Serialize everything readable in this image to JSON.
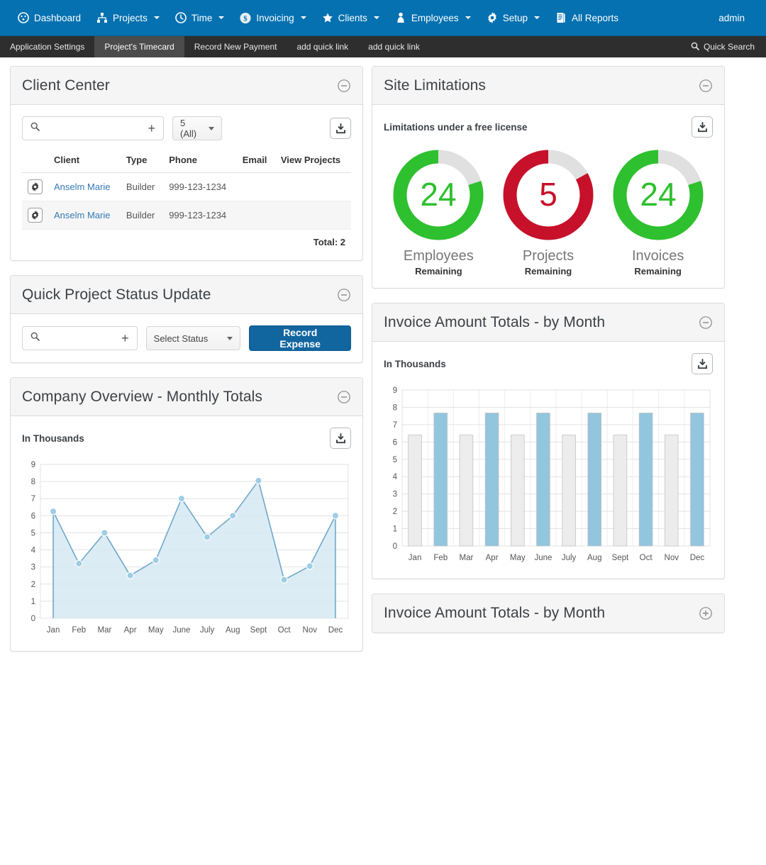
{
  "navbar": {
    "items": [
      {
        "label": "Dashboard",
        "icon": "dashboard-icon",
        "caret": false
      },
      {
        "label": "Projects",
        "icon": "sitemap-icon",
        "caret": true
      },
      {
        "label": "Time",
        "icon": "clock-icon",
        "caret": true
      },
      {
        "label": "Invoicing",
        "icon": "dollar-circle-icon",
        "caret": true
      },
      {
        "label": "Clients",
        "icon": "star-icon",
        "caret": true
      },
      {
        "label": "Employees",
        "icon": "user-tie-icon",
        "caret": true
      },
      {
        "label": "Setup",
        "icon": "gear-icon",
        "caret": true
      },
      {
        "label": "All Reports",
        "icon": "report-icon",
        "caret": false
      }
    ],
    "user": "admin",
    "brand_color": "#0571b0"
  },
  "subnav": {
    "items": [
      {
        "label": "Application Settings",
        "active": false
      },
      {
        "label": "Project's Timecard",
        "active": true
      },
      {
        "label": "Record New Payment",
        "active": false
      },
      {
        "label": "add quick link",
        "active": false
      },
      {
        "label": "add quick link",
        "active": false
      }
    ],
    "quick_search": "Quick Search",
    "background_color": "#2e2e2e"
  },
  "client_center": {
    "title": "Client Center",
    "search_placeholder": "",
    "search_value": "",
    "add_label": "+",
    "page_size": "5 (All)",
    "download_label": "download-icon",
    "columns": [
      "Client",
      "Type",
      "Phone",
      "Email",
      "View Projects"
    ],
    "rows": [
      {
        "client": "Anselm Marie",
        "type": "Builder",
        "phone": "999-123-1234",
        "email": "",
        "view_projects": ""
      },
      {
        "client": "Anselm Marie",
        "type": "Builder",
        "phone": "999-123-1234",
        "email": "",
        "view_projects": ""
      }
    ],
    "total": "Total: 2"
  },
  "site_limitations": {
    "title": "Site Limitations",
    "subtitle": "Limitations under a free license",
    "gauges": [
      {
        "value": "24",
        "name": "Employees",
        "sub": "Remaining",
        "percent": 80,
        "color": "#2ec02e"
      },
      {
        "value": "5",
        "name": "Projects",
        "sub": "Remaining",
        "percent": 83,
        "color": "#c7102a"
      },
      {
        "value": "24",
        "name": "Invoices",
        "sub": "Remaining",
        "percent": 80,
        "color": "#2ec02e"
      }
    ],
    "track_color": "#e0e0e0"
  },
  "quick_status": {
    "title": "Quick Project Status Update",
    "search_placeholder": "",
    "search_value": "",
    "add_label": "+",
    "status_select": "Select Status",
    "record_button": "Record Expense"
  },
  "company_overview": {
    "title": "Company Overview - Monthly Totals"
  },
  "invoice_totals": {
    "title": "Invoice Amount Totals - by Month"
  },
  "invoice_totals_collapsed": {
    "title": "Invoice Amount Totals - by Month"
  },
  "chart_data": [
    {
      "type": "area",
      "panel": "Company Overview - Monthly Totals",
      "title": "In Thousands",
      "xlabel": "",
      "ylabel": "",
      "ylim": [
        0,
        9
      ],
      "yticks": [
        0,
        1,
        2,
        3,
        4,
        5,
        6,
        7,
        8,
        9
      ],
      "grid": true,
      "legend": "none",
      "line_color": "#6fa8c8",
      "fill_color": "#d6e9f3",
      "point_color": "#9ecde4",
      "categories": [
        "Jan",
        "Feb",
        "Mar",
        "Apr",
        "May",
        "June",
        "July",
        "Aug",
        "Sept",
        "Oct",
        "Nov",
        "Dec"
      ],
      "values": [
        6.25,
        3.2,
        5.0,
        2.5,
        3.4,
        7.0,
        4.75,
        6.0,
        8.05,
        2.25,
        3.05,
        6.0
      ]
    },
    {
      "type": "bar",
      "panel": "Invoice Amount Totals - by Month",
      "title": "In Thousands",
      "xlabel": "",
      "ylabel": "",
      "ylim": [
        0,
        9
      ],
      "yticks": [
        0,
        1,
        2,
        3,
        4,
        5,
        6,
        7,
        8,
        9
      ],
      "grid": true,
      "legend": "none",
      "bar_colors": [
        "#ececec",
        "#92c5de",
        "#ececec",
        "#92c5de",
        "#ececec",
        "#92c5de",
        "#ececec",
        "#92c5de",
        "#ececec",
        "#92c5de",
        "#ececec",
        "#92c5de"
      ],
      "categories": [
        "Jan",
        "Feb",
        "Mar",
        "Apr",
        "May",
        "June",
        "July",
        "Aug",
        "Sept",
        "Oct",
        "Nov",
        "Dec"
      ],
      "values": [
        6.4,
        7.67,
        6.4,
        7.67,
        6.4,
        7.67,
        6.4,
        7.67,
        6.4,
        7.67,
        6.4,
        7.67
      ]
    }
  ]
}
